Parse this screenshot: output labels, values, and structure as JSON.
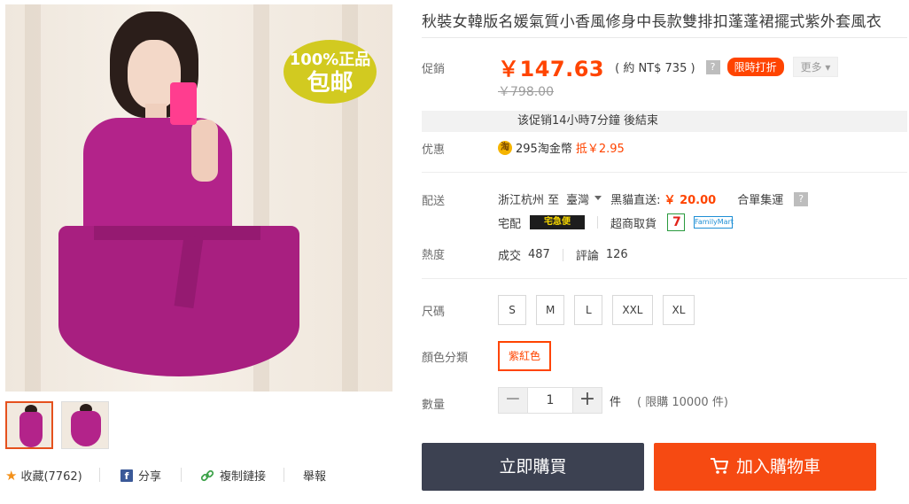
{
  "product": {
    "title": "秋裝女韓版名媛氣質小香風修身中長款雙排扣蓬蓬裙擺式紫外套風衣",
    "badge_line1": "100%正品",
    "badge_line2": "包邮"
  },
  "labels": {
    "promo": "促銷",
    "benefit": "优惠",
    "shipping": "配送",
    "heat": "熱度",
    "size": "尺碼",
    "color": "顏色分類",
    "quantity": "數量"
  },
  "price": {
    "current": "￥147.63",
    "converted": "( 約 NT$ 735 )",
    "help_icon": "?",
    "flash_tag": "限時打折",
    "more": "更多",
    "original": "￥798.00"
  },
  "countdown": "该促销14小時7分鐘 後結束",
  "coins": {
    "icon_text": "淘",
    "amount": "295淘金幣",
    "deduct": "抵￥2.95"
  },
  "shipping": {
    "origin": "浙江杭州 至",
    "destination": "臺灣",
    "fee_label": "黑貓直送:",
    "fee": "￥ 20.00",
    "consolidate": "合單集運",
    "help_icon": "?",
    "home_delivery": "宅配",
    "carrier_logo": "宅急便",
    "store_pickup": "超商取貨",
    "seven_logo": "7",
    "familymart_logo": "FamilyMart"
  },
  "heat": {
    "sold_label": "成交",
    "sold": "487",
    "reviews_label": "評論",
    "reviews": "126"
  },
  "sizes": [
    "S",
    "M",
    "L",
    "XXL",
    "XL"
  ],
  "colors": [
    {
      "label": "紫紅色",
      "selected": true
    }
  ],
  "quantity": {
    "minus": "−",
    "value": "1",
    "plus": "+",
    "unit": "件",
    "limit": "( 限購 10000 件)"
  },
  "actions": {
    "buy_now": "立即購買",
    "add_to_cart": "加入購物車"
  },
  "social": {
    "favorite": "收藏(7762)",
    "share": "分享",
    "copy_link": "複制鏈接",
    "report": "舉報"
  },
  "icons": {
    "star": "star-icon",
    "facebook": "facebook-icon",
    "link": "link-icon",
    "cart": "cart-icon"
  },
  "colors_theme": {
    "accent": "#ff4400",
    "buy_button": "#3c4151",
    "cart_button": "#f64a12"
  }
}
